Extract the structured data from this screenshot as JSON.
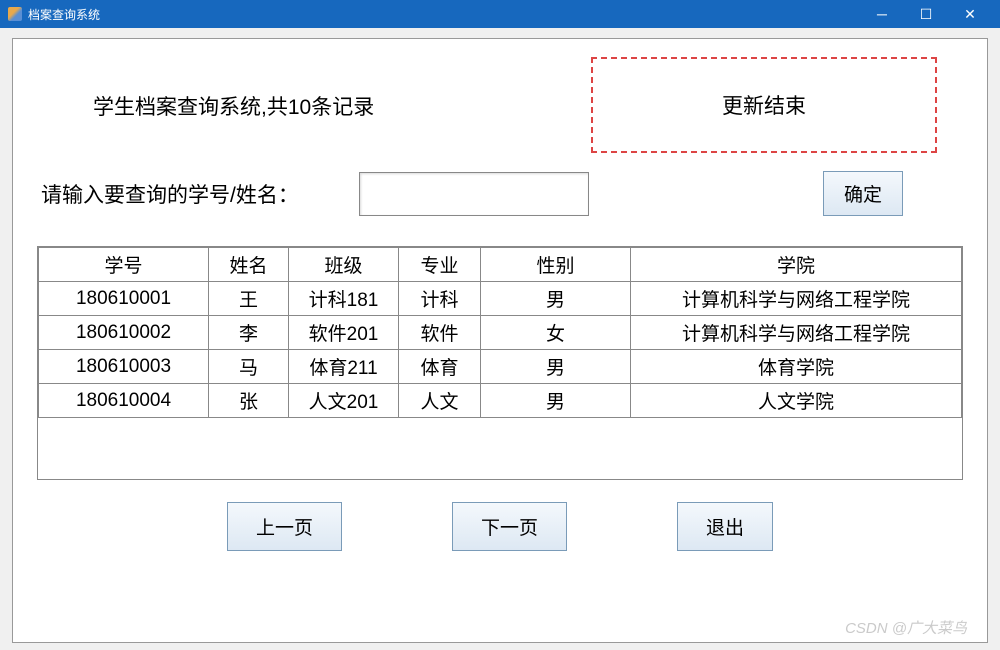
{
  "window": {
    "title": "档案查询系统"
  },
  "header": {
    "title": "学生档案查询系统,共10条记录",
    "status": "更新结束"
  },
  "search": {
    "label": "请输入要查询的学号/姓名：",
    "value": "",
    "confirm_label": "确定"
  },
  "table": {
    "columns": [
      "学号",
      "姓名",
      "班级",
      "专业",
      "性别",
      "学院"
    ],
    "rows": [
      [
        "180610001",
        "王",
        "计科181",
        "计科",
        "男",
        "计算机科学与网络工程学院"
      ],
      [
        "180610002",
        "李",
        "软件201",
        "软件",
        "女",
        "计算机科学与网络工程学院"
      ],
      [
        "180610003",
        "马",
        "体育211",
        "体育",
        "男",
        "体育学院"
      ],
      [
        "180610004",
        "张",
        "人文201",
        "人文",
        "男",
        "人文学院"
      ]
    ]
  },
  "buttons": {
    "prev": "上一页",
    "next": "下一页",
    "exit": "退出"
  },
  "watermark": "CSDN @广大菜鸟"
}
